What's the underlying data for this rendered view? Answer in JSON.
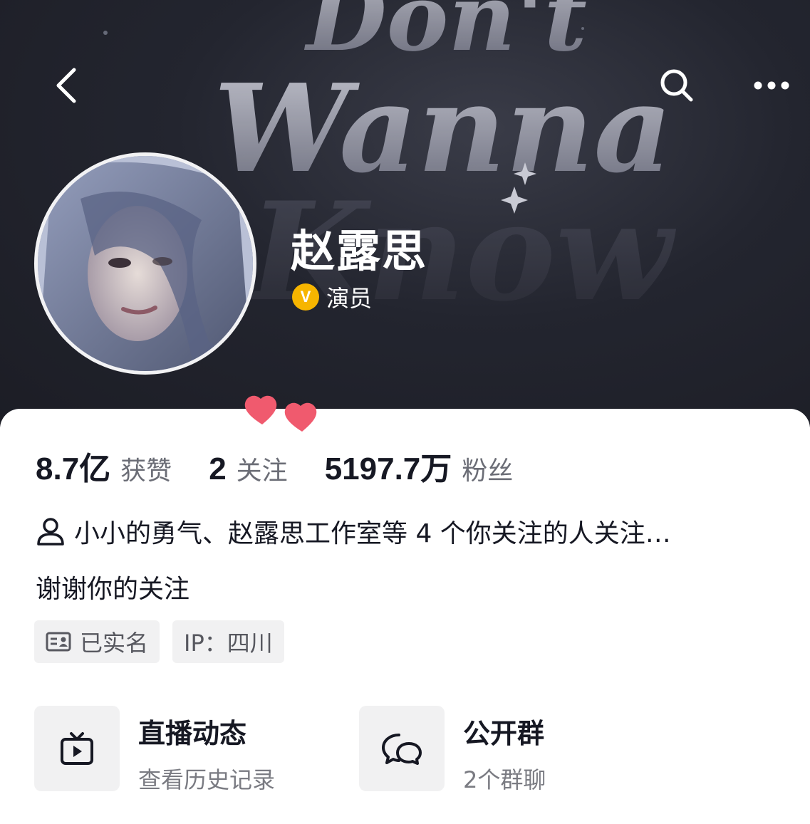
{
  "header": {
    "banner_text": [
      "Don't",
      "Wanna",
      "Know"
    ],
    "back_icon": "chevron-left-icon",
    "search_icon": "search-icon",
    "more_icon": "more-horizontal-icon"
  },
  "profile": {
    "name": "赵露思",
    "verified_label": "演员",
    "verified_badge": "V"
  },
  "stats": [
    {
      "value": "8.7亿",
      "label": "获赞"
    },
    {
      "value": "2",
      "label": "关注"
    },
    {
      "value": "5197.7万",
      "label": "粉丝"
    }
  ],
  "mutual": {
    "text": "小小的勇气、赵露思工作室等 4 个你关注的人关注…"
  },
  "bio": "谢谢你的关注",
  "tags": [
    {
      "label": "已实名",
      "icon": "id-card-icon"
    },
    {
      "label": "IP：四川"
    }
  ],
  "cards": [
    {
      "title": "直播动态",
      "subtitle": "查看历史记录",
      "icon": "tv-play-icon"
    },
    {
      "title": "公开群",
      "subtitle": "2个群聊",
      "icon": "chat-bubbles-icon"
    }
  ],
  "colors": {
    "banner_dark": "#1c1d25",
    "badge_gold": "#f7b500",
    "heart_pink": "#f05a6e",
    "text_primary": "#161823",
    "text_secondary": "#6b6d76"
  }
}
